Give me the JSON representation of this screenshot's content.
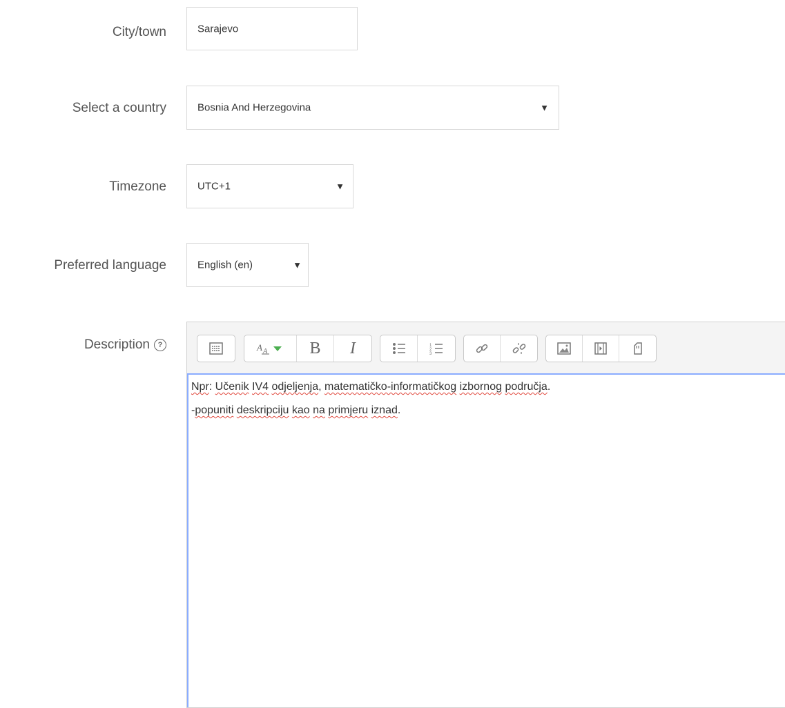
{
  "fields": {
    "city": {
      "label": "City/town",
      "value": "Sarajevo"
    },
    "country": {
      "label": "Select a country",
      "value": "Bosnia And Herzegovina"
    },
    "timezone": {
      "label": "Timezone",
      "value": "UTC+1"
    },
    "language": {
      "label": "Preferred language",
      "value": "English (en)"
    },
    "description": {
      "label": "Description",
      "help_icon": "?",
      "lines": [
        [
          {
            "t": "Npr",
            "sp": true
          },
          {
            "t": ": "
          },
          {
            "t": "Učenik",
            "sp": true
          },
          {
            "t": " "
          },
          {
            "t": "IV4",
            "sp": true
          },
          {
            "t": " "
          },
          {
            "t": "odjeljenja",
            "sp": true
          },
          {
            "t": ", "
          },
          {
            "t": "matematičko-informatičkog",
            "sp": true
          },
          {
            "t": " "
          },
          {
            "t": "izbornog",
            "sp": true
          },
          {
            "t": " "
          },
          {
            "t": "područja",
            "sp": true
          },
          {
            "t": "."
          }
        ],
        [
          {
            "t": "-"
          },
          {
            "t": "popuniti",
            "sp": true
          },
          {
            "t": " "
          },
          {
            "t": "deskripciju",
            "sp": true
          },
          {
            "t": " "
          },
          {
            "t": "kao",
            "sp": true
          },
          {
            "t": " "
          },
          {
            "t": "na",
            "sp": true
          },
          {
            "t": " "
          },
          {
            "t": "primjeru",
            "sp": true
          },
          {
            "t": " "
          },
          {
            "t": "iznad",
            "sp": true
          },
          {
            "t": "."
          }
        ]
      ]
    }
  },
  "caret_glyph": "▼",
  "toolbar": {
    "bold": "B",
    "italic": "I",
    "icons": [
      "toolbar-toggle-icon",
      "paragraph-style-icon",
      "bold-icon",
      "italic-icon",
      "bullet-list-icon",
      "numbered-list-icon",
      "link-icon",
      "unlink-icon",
      "image-icon",
      "media-icon",
      "file-icon"
    ]
  },
  "colors": {
    "accent_border": "#8aacff",
    "spell_underline": "#e0453a",
    "style_arrow": "#4caf50"
  }
}
